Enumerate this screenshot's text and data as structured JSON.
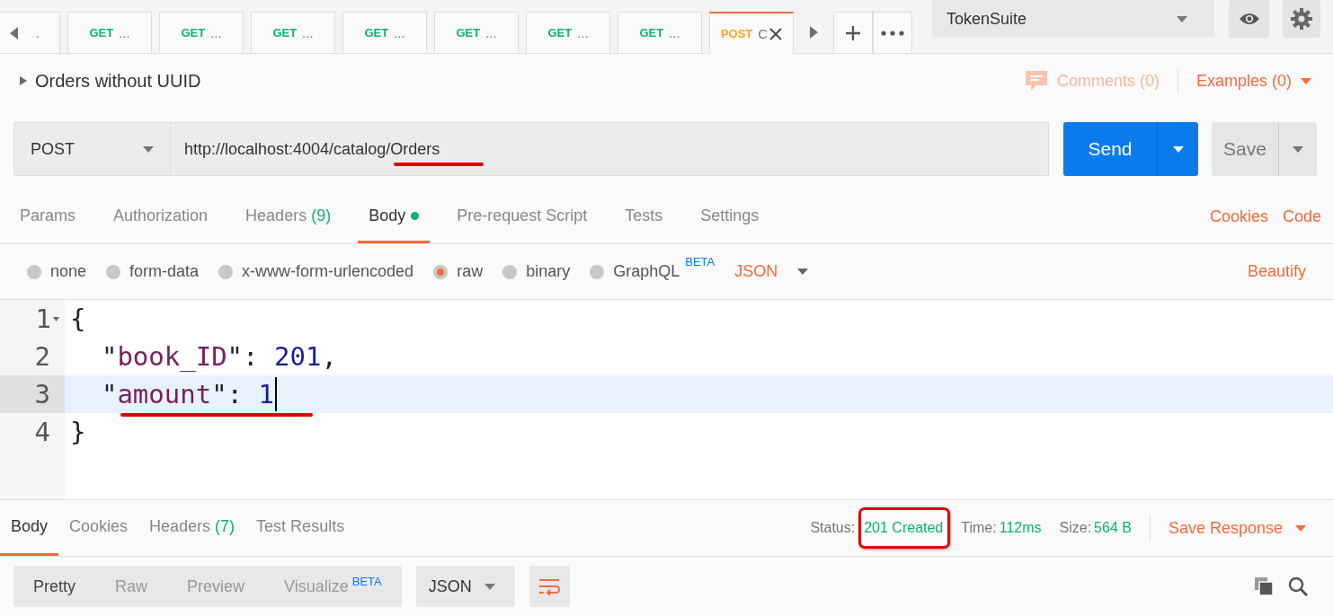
{
  "request_tabs": [
    {
      "label": ".",
      "selected": false,
      "partial": true
    },
    {
      "method": "GET",
      "label": "...",
      "selected": false
    },
    {
      "method": "GET",
      "label": "...",
      "selected": false
    },
    {
      "method": "GET",
      "label": "...",
      "selected": false
    },
    {
      "method": "GET",
      "label": "...",
      "selected": false
    },
    {
      "method": "GET",
      "label": "...",
      "selected": false
    },
    {
      "method": "GET",
      "label": "...",
      "selected": false
    },
    {
      "method": "GET",
      "label": "...",
      "selected": false
    },
    {
      "method": "POST",
      "label": "C",
      "selected": true
    }
  ],
  "environment": {
    "value": "TokenSuite"
  },
  "request": {
    "name": "Orders without UUID",
    "comments": "Comments (0)",
    "examples": "Examples (0)",
    "method": "POST",
    "url": "http://localhost:4004/catalog/Orders",
    "send": "Send",
    "save": "Save"
  },
  "config_tabs": [
    {
      "label": "Params",
      "selected": false
    },
    {
      "label": "Authorization",
      "selected": false
    },
    {
      "label": "Headers",
      "count": "(9)",
      "selected": false
    },
    {
      "label": "Body",
      "dot": true,
      "selected": true
    },
    {
      "label": "Pre-request Script",
      "selected": false
    },
    {
      "label": "Tests",
      "selected": false
    },
    {
      "label": "Settings",
      "selected": false
    }
  ],
  "config_links": [
    "Cookies",
    "Code"
  ],
  "body_types": [
    {
      "label": "none",
      "selected": false
    },
    {
      "label": "form-data",
      "selected": false
    },
    {
      "label": "x-www-form-urlencoded",
      "selected": false
    },
    {
      "label": "raw",
      "selected": true
    },
    {
      "label": "binary",
      "selected": false
    },
    {
      "label": "GraphQL",
      "badge": "BETA",
      "selected": false
    }
  ],
  "body_format": "JSON",
  "beautify": "Beautify",
  "editor": {
    "lines": [
      {
        "number": "1",
        "current": false,
        "tokens": [
          {
            "kind": "punct",
            "text": "{"
          }
        ]
      },
      {
        "number": "2",
        "current": false,
        "tokens": [
          {
            "kind": "punct",
            "text": "  \""
          },
          {
            "kind": "key",
            "text": "book_ID"
          },
          {
            "kind": "punct",
            "text": "\": "
          },
          {
            "kind": "number",
            "text": "201"
          },
          {
            "kind": "punct",
            "text": ","
          }
        ]
      },
      {
        "number": "3",
        "current": true,
        "tokens": [
          {
            "kind": "punct",
            "text": "  \""
          },
          {
            "kind": "key",
            "text": "amount"
          },
          {
            "kind": "punct",
            "text": "\": "
          },
          {
            "kind": "number",
            "text": "1"
          }
        ]
      },
      {
        "number": "4",
        "current": false,
        "tokens": [
          {
            "kind": "punct",
            "text": "}"
          }
        ]
      }
    ]
  },
  "response_tabs": [
    {
      "label": "Body",
      "selected": true
    },
    {
      "label": "Cookies",
      "selected": false
    },
    {
      "label": "Headers",
      "count": "(7)",
      "selected": false
    },
    {
      "label": "Test Results",
      "selected": false
    }
  ],
  "response_meta": [
    {
      "label": "Status:",
      "value": "201 Created"
    },
    {
      "label": "Time:",
      "value": "112ms"
    },
    {
      "label": "Size:",
      "value": "564 B"
    }
  ],
  "save_response": "Save Response",
  "view_modes": [
    {
      "label": "Pretty",
      "selected": true
    },
    {
      "label": "Raw",
      "selected": false
    },
    {
      "label": "Preview",
      "selected": false
    },
    {
      "label": "Visualize",
      "badge": "BETA",
      "selected": false
    }
  ],
  "response_format": "JSON"
}
